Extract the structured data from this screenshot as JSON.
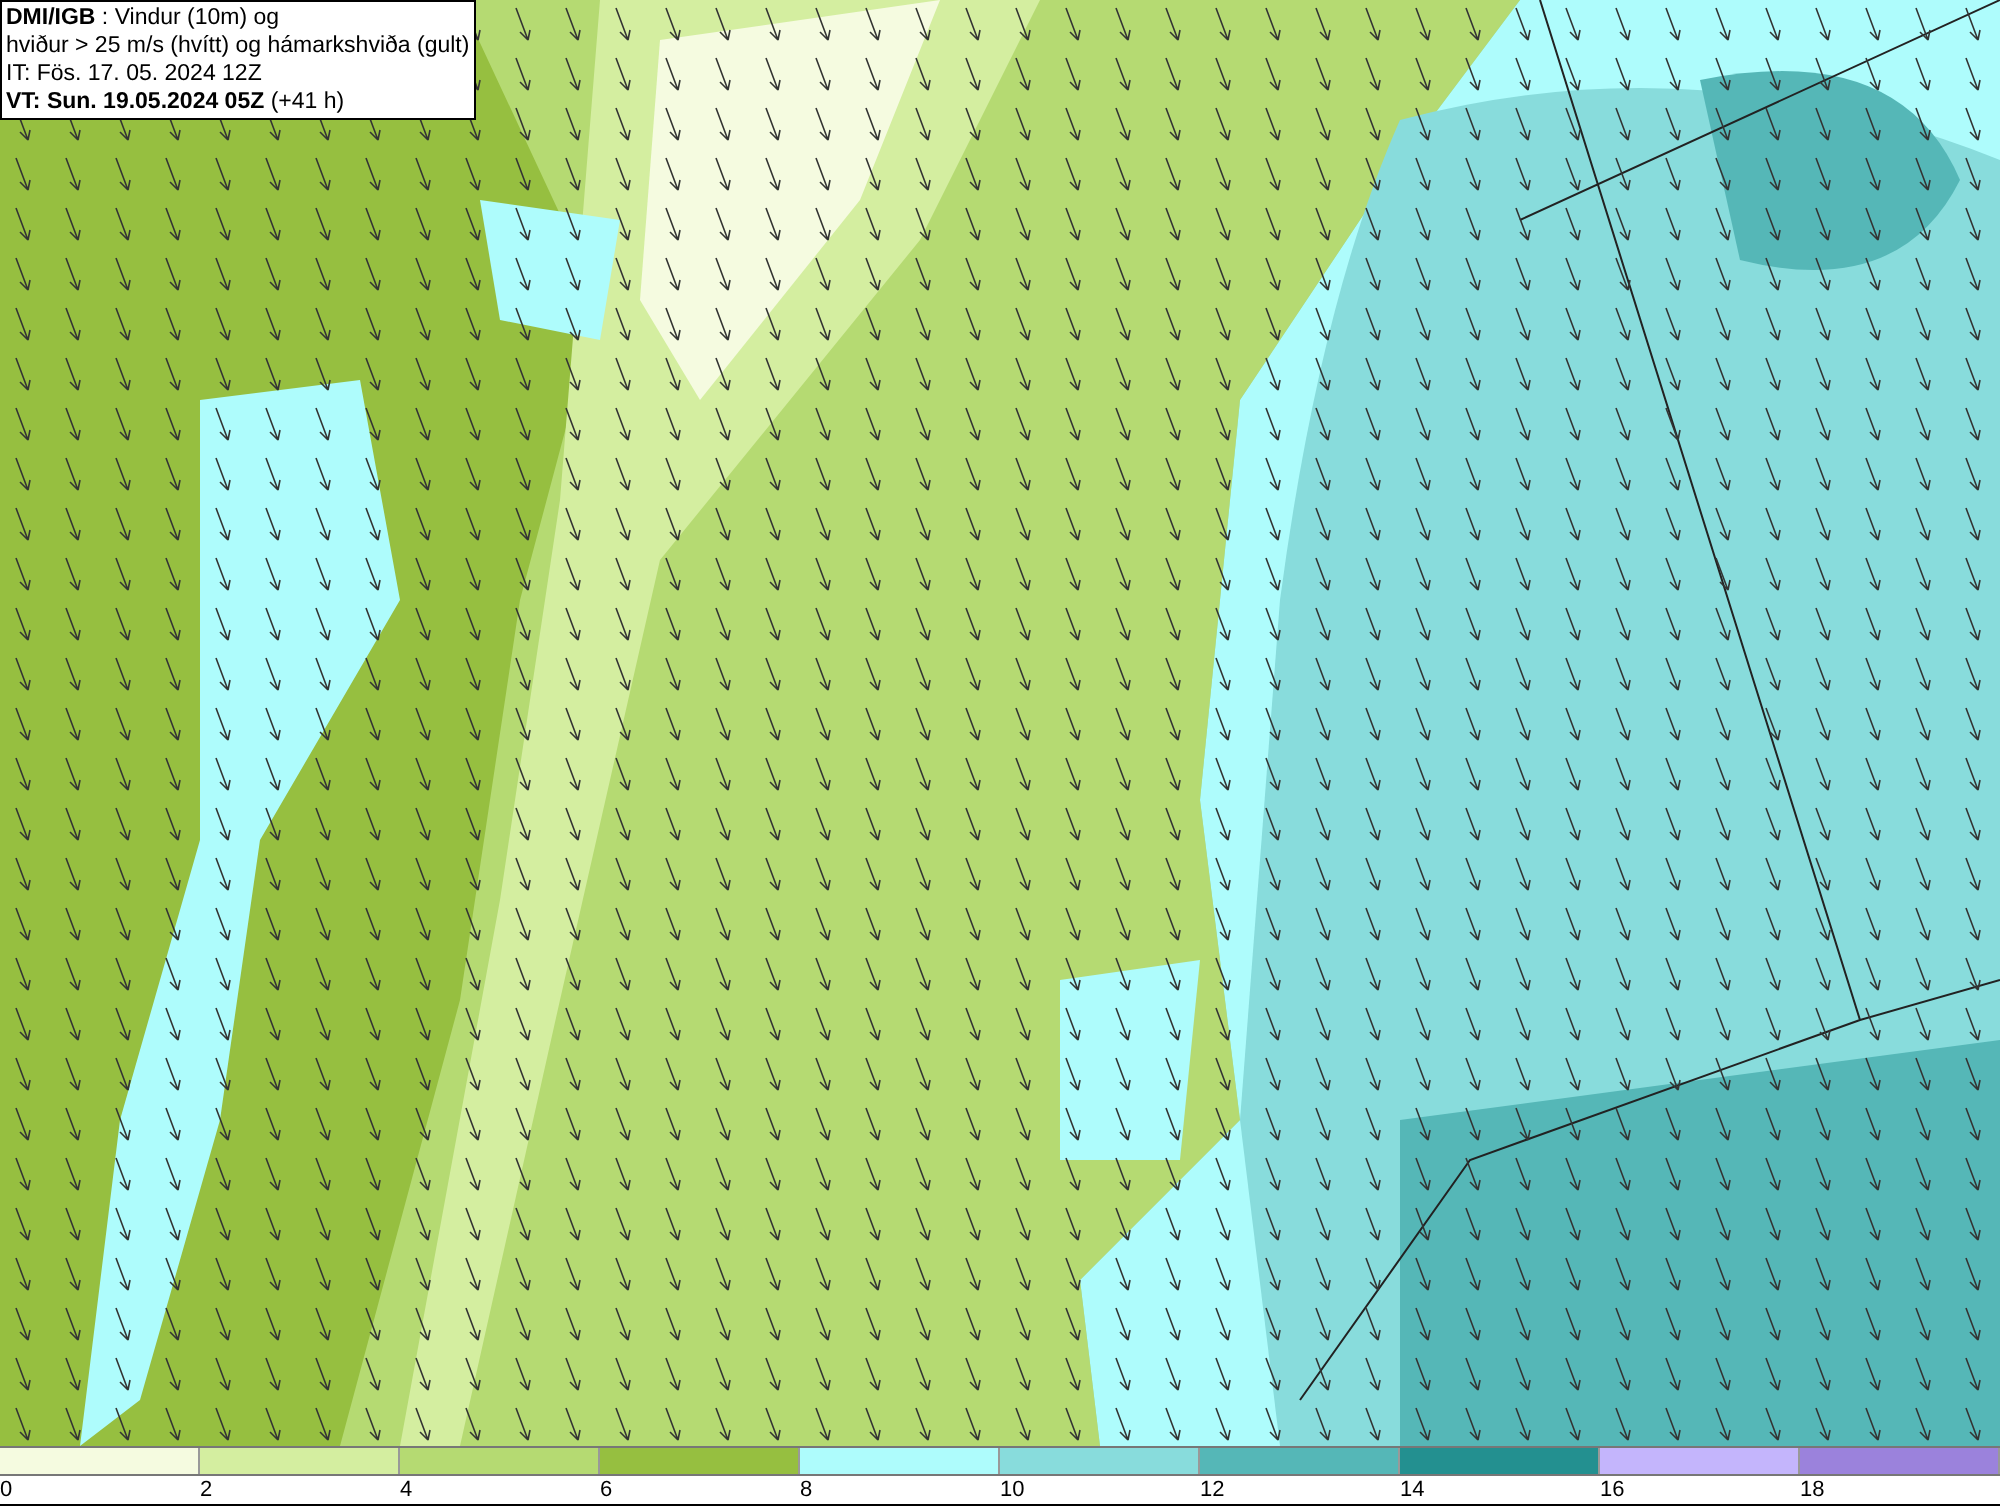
{
  "header": {
    "lines": [
      "**DMI/IGB** : Vindur (10m) og",
      "hviður > 25 m/s (hvítt) og hámarkshviða (gult)",
      "IT: Fös. 17. 05. 2024 12Z",
      "**VT: Sun. 19.05.2024 05Z** (+41 h)"
    ]
  },
  "legend": {
    "bins": [
      {
        "label": "0",
        "color": "#f5fbe0"
      },
      {
        "label": "2",
        "color": "#d4eea0"
      },
      {
        "label": "4",
        "color": "#b5da72"
      },
      {
        "label": "6",
        "color": "#96bf40"
      },
      {
        "label": "8",
        "color": "#aefcfc"
      },
      {
        "label": "10",
        "color": "#88dcdc"
      },
      {
        "label": "12",
        "color": "#55b7b7"
      },
      {
        "label": "14",
        "color": "#239090"
      },
      {
        "label": "16",
        "color": "#c4b5fc"
      },
      {
        "label": "18",
        "color": "#9b82dc"
      }
    ]
  }
}
